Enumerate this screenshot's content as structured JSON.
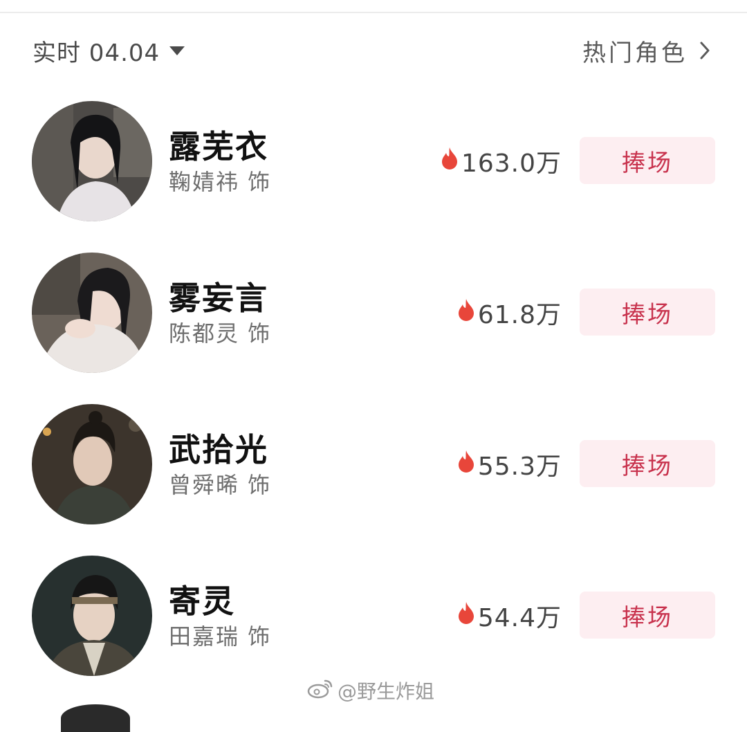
{
  "header": {
    "period_label": "实时 04.04",
    "hot_roles_label": "热门角色"
  },
  "colors": {
    "accent": "#c8324d",
    "button_bg": "#fdeef1",
    "flame": "#e8463a"
  },
  "roles": [
    {
      "role": "露芜衣",
      "actor": "鞠婧祎 饰",
      "heat": "163.0万",
      "button": "捧场"
    },
    {
      "role": "雾妄言",
      "actor": "陈都灵 饰",
      "heat": "61.8万",
      "button": "捧场"
    },
    {
      "role": "武拾光",
      "actor": "曾舜晞 饰",
      "heat": "55.3万",
      "button": "捧场"
    },
    {
      "role": "寄灵",
      "actor": "田嘉瑞 饰",
      "heat": "54.4万",
      "button": "捧场"
    }
  ],
  "watermark": "@野生炸姐"
}
